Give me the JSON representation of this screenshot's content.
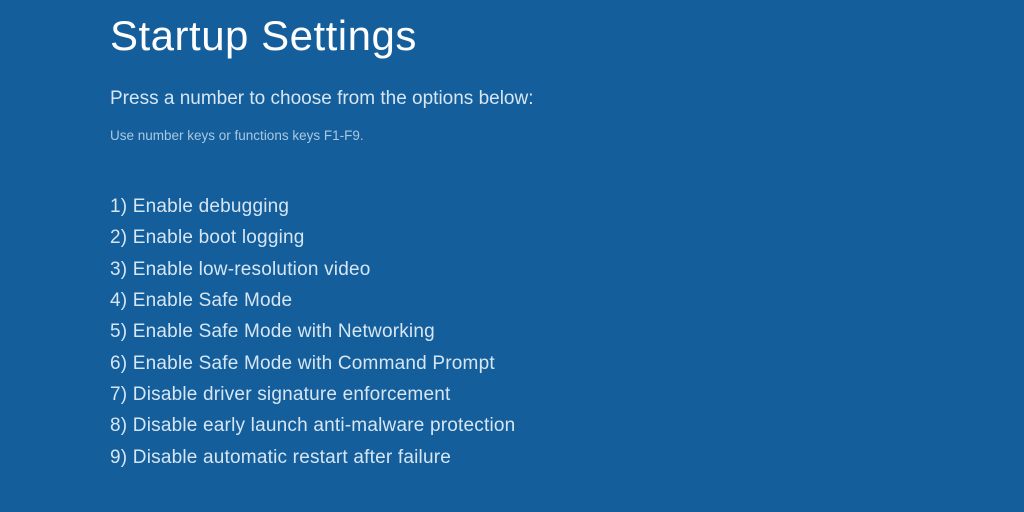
{
  "title": "Startup Settings",
  "subtitle": "Press a number to choose from the options below:",
  "hint": "Use number keys or functions keys F1-F9.",
  "options": [
    "1) Enable debugging",
    "2) Enable boot logging",
    "3) Enable low-resolution video",
    "4) Enable Safe Mode",
    "5) Enable Safe Mode with Networking",
    "6) Enable Safe Mode with Command Prompt",
    "7) Disable driver signature enforcement",
    "8) Disable early launch anti-malware protection",
    "9) Disable automatic restart after failure"
  ]
}
